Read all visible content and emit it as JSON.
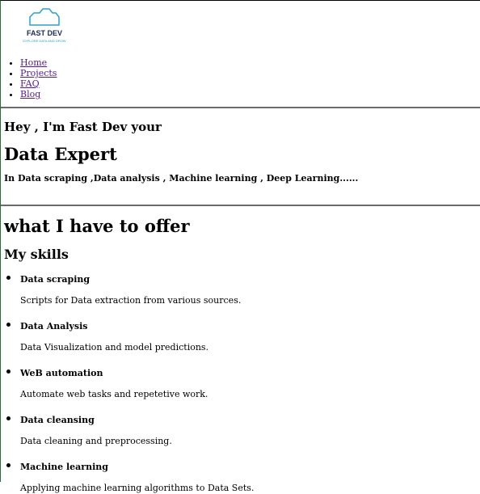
{
  "logo": {
    "name": "FAST DEV",
    "tagline": "EXPLORE DATA AND GROW",
    "colors": {
      "outline": "#2aa0c8",
      "name": "#1c2a5a",
      "tagline": "#2aa0c8"
    }
  },
  "nav": [
    {
      "label": "Home"
    },
    {
      "label": "Projects"
    },
    {
      "label": "FAQ"
    },
    {
      "label": "Blog"
    }
  ],
  "hero": {
    "greeting": "Hey , I'm Fast Dev your",
    "title": "Data Expert",
    "subtitle": "In Data scraping ,Data analysis , Machine learning , Deep Learning......"
  },
  "offer": {
    "heading": "what I have to offer",
    "skills_heading": "My skills",
    "skills": [
      {
        "name": "Data scraping",
        "desc": "Scripts for Data extraction from various sources."
      },
      {
        "name": "Data Analysis",
        "desc": "Data Visualization and model predictions."
      },
      {
        "name": "WeB automation",
        "desc": "Automate web tasks and repetetive work."
      },
      {
        "name": "Data cleansing",
        "desc": "Data cleaning and preprocessing."
      },
      {
        "name": "Machine learning",
        "desc": "Applying machine learning algorithms to Data Sets."
      }
    ]
  }
}
